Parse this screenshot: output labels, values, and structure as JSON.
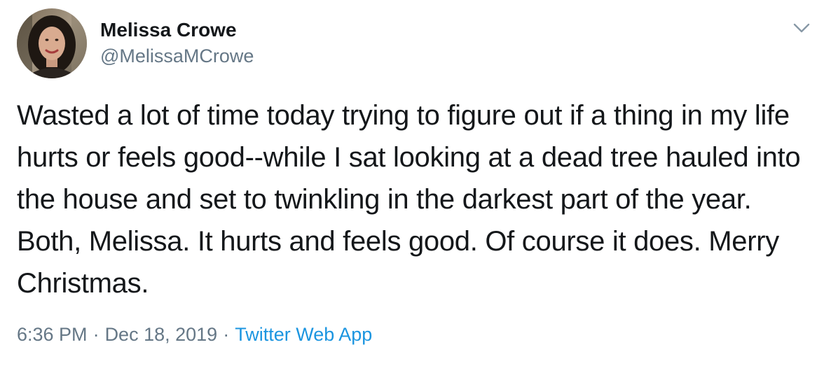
{
  "tweet": {
    "author": {
      "name": "Melissa Crowe",
      "handle": "@MelissaMCrowe"
    },
    "text": "Wasted a lot of time today trying to figure out if a thing in my life hurts or feels good--while I sat looking at a dead tree hauled into the house and set to twinkling in the darkest part of the year. Both, Melissa. It hurts and feels good. Of course it does. Merry Christmas.",
    "time": "6:36 PM",
    "date": "Dec 18, 2019",
    "separator": "·",
    "source": "Twitter Web App",
    "menu_icon": "chevron-down-icon"
  },
  "colors": {
    "text_primary": "#14171a",
    "text_secondary": "#657786",
    "link": "#1b95e0"
  }
}
